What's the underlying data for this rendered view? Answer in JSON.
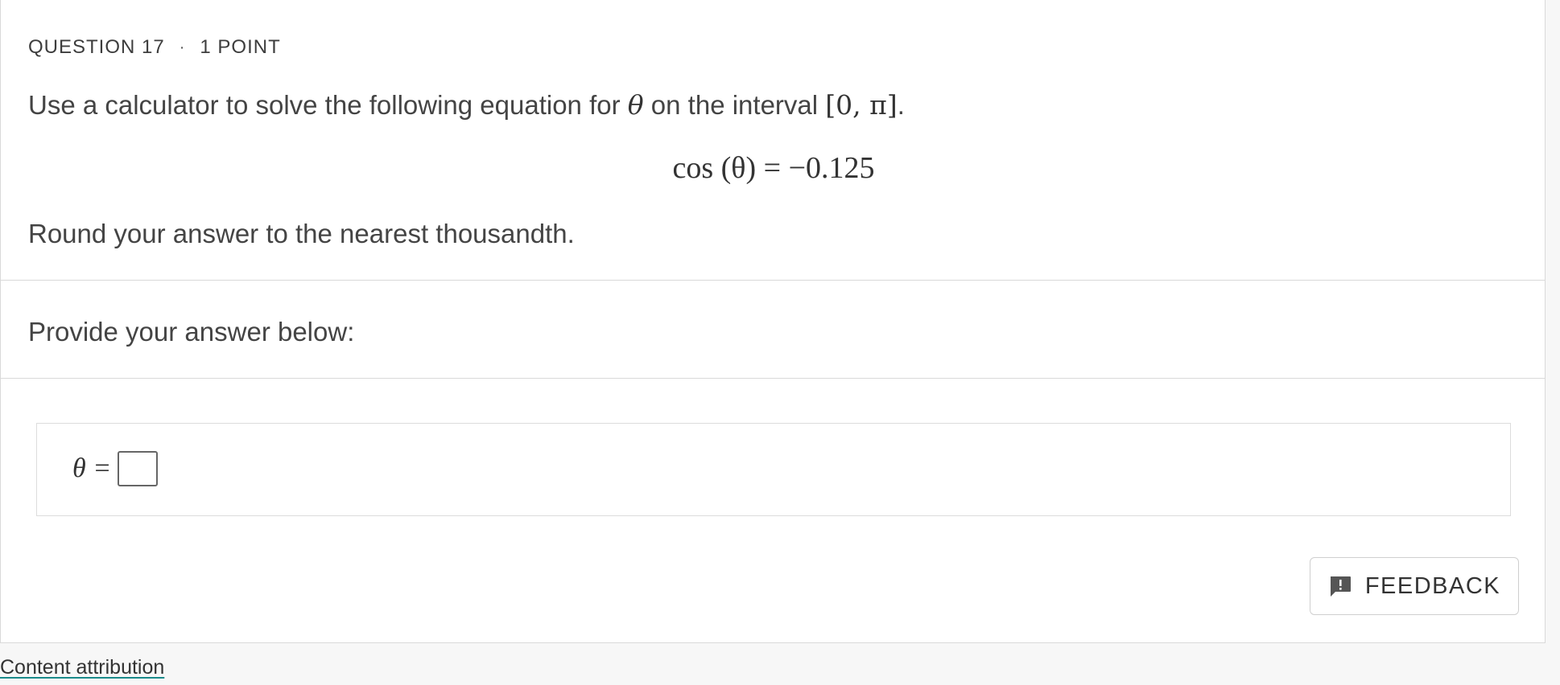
{
  "question": {
    "number_label": "QUESTION 17",
    "separator": "·",
    "points_label": "1 POINT",
    "prompt_prefix": "Use a calculator to solve the following equation for ",
    "prompt_var": "θ",
    "prompt_middle": " on the interval ",
    "prompt_interval": "[0, π]",
    "prompt_suffix": ".",
    "equation": "cos (θ) = −0.125",
    "instruction": "Round your answer to the nearest thousandth."
  },
  "answer_section": {
    "heading": "Provide your answer below:",
    "label": "θ =",
    "input_value": ""
  },
  "feedback": {
    "label": "FEEDBACK",
    "icon": "feedback-icon"
  },
  "footer": {
    "attribution_link": "Content attribution"
  }
}
